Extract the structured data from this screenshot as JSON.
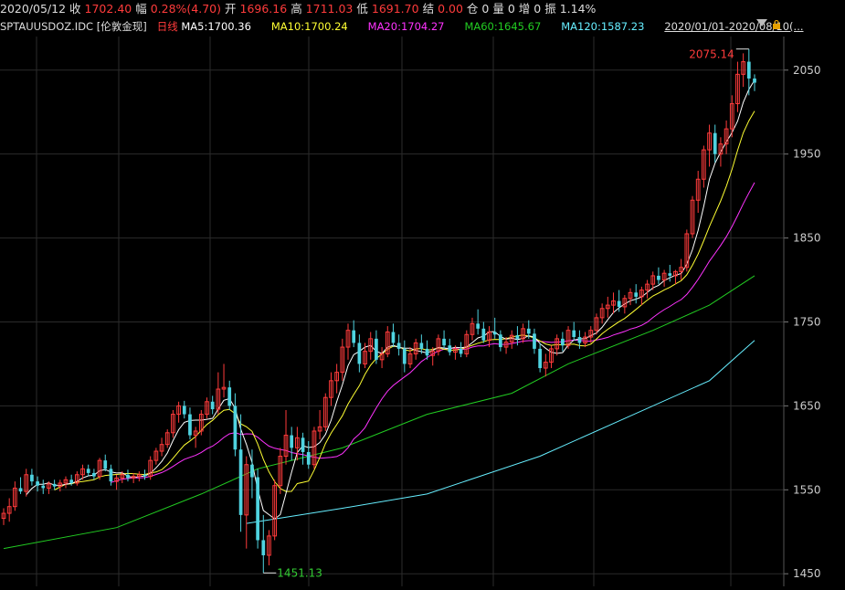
{
  "header": {
    "date": "2020/05/12",
    "close_label": "收",
    "close_value": "1702.40",
    "change_label": "幅",
    "change_value": "0.28%(4.70)",
    "open_label": "开",
    "open_value": "1696.16",
    "high_label": "高",
    "high_value": "1711.03",
    "low_label": "低",
    "low_value": "1691.70",
    "settle_label": "结",
    "settle_value": "0.00",
    "position_label": "仓",
    "position_value": "0",
    "volume_label": "量",
    "volume_value": "0",
    "increase_label": "增",
    "increase_value": "0",
    "amplitude_label": "振",
    "amplitude_value": "1.14%"
  },
  "legend": {
    "symbol": "SPTAUUSDOZ.IDC",
    "name": "[伦敦金现]",
    "period": "日线",
    "ma5": "MA5:1700.36",
    "ma10": "MA10:1700.24",
    "ma20": "MA20:1704.27",
    "ma60": "MA60:1645.67",
    "ma120": "MA120:1587.23",
    "range": "2020/01/01-2020/08/10(..."
  },
  "colors": {
    "up": "#ff3b3b",
    "down": "#4fd3e0",
    "ma5": "#ffffff",
    "ma10": "#ffff33",
    "ma20": "#ff33ff",
    "ma60": "#22cc22",
    "ma120": "#66eeff",
    "grid": "#2b2b2b",
    "high_label": "#ff3b3b",
    "low_label": "#33cc33"
  },
  "chart_data": {
    "type": "candlestick",
    "ylim": [
      1435,
      2090
    ],
    "y_ticks": [
      1450,
      1550,
      1650,
      1750,
      1850,
      1950,
      2050
    ],
    "grid": true,
    "annotations": {
      "max": "2075.14",
      "min": "1451.13"
    },
    "x_range": [
      "2020/01/01",
      "2020/08/10"
    ],
    "candles": [
      [
        1516,
        1528,
        1508,
        1522
      ],
      [
        1522,
        1540,
        1512,
        1530
      ],
      [
        1530,
        1560,
        1525,
        1552
      ],
      [
        1552,
        1565,
        1545,
        1548
      ],
      [
        1548,
        1575,
        1542,
        1568
      ],
      [
        1568,
        1575,
        1555,
        1560
      ],
      [
        1560,
        1566,
        1548,
        1555
      ],
      [
        1555,
        1562,
        1545,
        1552
      ],
      [
        1552,
        1560,
        1545,
        1557
      ],
      [
        1557,
        1562,
        1550,
        1554
      ],
      [
        1554,
        1562,
        1548,
        1558
      ],
      [
        1558,
        1566,
        1552,
        1562
      ],
      [
        1562,
        1568,
        1555,
        1558
      ],
      [
        1558,
        1572,
        1555,
        1568
      ],
      [
        1568,
        1580,
        1562,
        1575
      ],
      [
        1575,
        1580,
        1566,
        1570
      ],
      [
        1570,
        1575,
        1562,
        1566
      ],
      [
        1566,
        1588,
        1562,
        1585
      ],
      [
        1585,
        1592,
        1572,
        1575
      ],
      [
        1575,
        1580,
        1555,
        1560
      ],
      [
        1560,
        1568,
        1550,
        1564
      ],
      [
        1564,
        1572,
        1558,
        1568
      ],
      [
        1568,
        1574,
        1560,
        1564
      ],
      [
        1564,
        1570,
        1558,
        1566
      ],
      [
        1566,
        1572,
        1560,
        1568
      ],
      [
        1568,
        1574,
        1562,
        1566
      ],
      [
        1566,
        1590,
        1562,
        1585
      ],
      [
        1585,
        1600,
        1580,
        1596
      ],
      [
        1596,
        1612,
        1590,
        1604
      ],
      [
        1604,
        1622,
        1600,
        1618
      ],
      [
        1618,
        1645,
        1612,
        1640
      ],
      [
        1640,
        1655,
        1630,
        1650
      ],
      [
        1650,
        1656,
        1635,
        1640
      ],
      [
        1640,
        1648,
        1610,
        1615
      ],
      [
        1615,
        1625,
        1600,
        1620
      ],
      [
        1620,
        1645,
        1615,
        1640
      ],
      [
        1640,
        1660,
        1635,
        1655
      ],
      [
        1655,
        1662,
        1640,
        1646
      ],
      [
        1646,
        1690,
        1640,
        1670
      ],
      [
        1670,
        1700,
        1660,
        1672
      ],
      [
        1672,
        1680,
        1645,
        1650
      ],
      [
        1650,
        1665,
        1590,
        1598
      ],
      [
        1598,
        1640,
        1500,
        1520
      ],
      [
        1520,
        1590,
        1480,
        1580
      ],
      [
        1580,
        1598,
        1540,
        1565
      ],
      [
        1565,
        1575,
        1480,
        1490
      ],
      [
        1490,
        1520,
        1451,
        1472
      ],
      [
        1472,
        1502,
        1460,
        1495
      ],
      [
        1495,
        1562,
        1490,
        1555
      ],
      [
        1555,
        1600,
        1545,
        1590
      ],
      [
        1590,
        1645,
        1580,
        1615
      ],
      [
        1615,
        1625,
        1585,
        1600
      ],
      [
        1600,
        1625,
        1585,
        1612
      ],
      [
        1612,
        1618,
        1580,
        1595
      ],
      [
        1595,
        1608,
        1575,
        1580
      ],
      [
        1580,
        1625,
        1575,
        1620
      ],
      [
        1620,
        1645,
        1610,
        1625
      ],
      [
        1625,
        1665,
        1620,
        1660
      ],
      [
        1660,
        1690,
        1650,
        1680
      ],
      [
        1680,
        1700,
        1665,
        1690
      ],
      [
        1690,
        1730,
        1680,
        1720
      ],
      [
        1720,
        1748,
        1705,
        1740
      ],
      [
        1740,
        1752,
        1720,
        1725
      ],
      [
        1725,
        1735,
        1690,
        1700
      ],
      [
        1700,
        1725,
        1695,
        1715
      ],
      [
        1715,
        1738,
        1705,
        1730
      ],
      [
        1730,
        1740,
        1700,
        1705
      ],
      [
        1705,
        1720,
        1695,
        1712
      ],
      [
        1712,
        1745,
        1708,
        1738
      ],
      [
        1738,
        1748,
        1720,
        1725
      ],
      [
        1725,
        1735,
        1710,
        1718
      ],
      [
        1718,
        1728,
        1690,
        1700
      ],
      [
        1700,
        1720,
        1695,
        1712
      ],
      [
        1712,
        1730,
        1705,
        1725
      ],
      [
        1725,
        1735,
        1712,
        1718
      ],
      [
        1718,
        1728,
        1705,
        1710
      ],
      [
        1710,
        1720,
        1698,
        1715
      ],
      [
        1715,
        1735,
        1710,
        1730
      ],
      [
        1730,
        1740,
        1718,
        1722
      ],
      [
        1722,
        1730,
        1710,
        1714
      ],
      [
        1714,
        1722,
        1705,
        1718
      ],
      [
        1718,
        1726,
        1708,
        1712
      ],
      [
        1712,
        1740,
        1708,
        1735
      ],
      [
        1735,
        1755,
        1728,
        1748
      ],
      [
        1748,
        1765,
        1735,
        1742
      ],
      [
        1742,
        1750,
        1725,
        1728
      ],
      [
        1728,
        1745,
        1720,
        1738
      ],
      [
        1738,
        1755,
        1730,
        1735
      ],
      [
        1735,
        1740,
        1715,
        1720
      ],
      [
        1720,
        1732,
        1712,
        1726
      ],
      [
        1726,
        1740,
        1718,
        1734
      ],
      [
        1734,
        1745,
        1722,
        1730
      ],
      [
        1730,
        1748,
        1725,
        1742
      ],
      [
        1742,
        1752,
        1730,
        1736
      ],
      [
        1736,
        1742,
        1712,
        1718
      ],
      [
        1718,
        1725,
        1690,
        1695
      ],
      [
        1695,
        1712,
        1685,
        1702
      ],
      [
        1702,
        1722,
        1695,
        1718
      ],
      [
        1718,
        1735,
        1710,
        1730
      ],
      [
        1730,
        1738,
        1715,
        1722
      ],
      [
        1722,
        1745,
        1718,
        1740
      ],
      [
        1740,
        1750,
        1728,
        1732
      ],
      [
        1732,
        1740,
        1718,
        1725
      ],
      [
        1725,
        1738,
        1720,
        1732
      ],
      [
        1732,
        1745,
        1725,
        1740
      ],
      [
        1740,
        1760,
        1735,
        1755
      ],
      [
        1755,
        1772,
        1748,
        1766
      ],
      [
        1766,
        1780,
        1755,
        1770
      ],
      [
        1770,
        1785,
        1760,
        1775
      ],
      [
        1775,
        1788,
        1762,
        1768
      ],
      [
        1768,
        1782,
        1760,
        1778
      ],
      [
        1778,
        1790,
        1770,
        1785
      ],
      [
        1785,
        1795,
        1772,
        1780
      ],
      [
        1780,
        1792,
        1770,
        1788
      ],
      [
        1788,
        1800,
        1778,
        1795
      ],
      [
        1795,
        1810,
        1788,
        1805
      ],
      [
        1805,
        1815,
        1795,
        1800
      ],
      [
        1800,
        1812,
        1792,
        1808
      ],
      [
        1808,
        1818,
        1798,
        1805
      ],
      [
        1805,
        1812,
        1795,
        1810
      ],
      [
        1810,
        1825,
        1800,
        1815
      ],
      [
        1815,
        1860,
        1810,
        1855
      ],
      [
        1855,
        1900,
        1850,
        1895
      ],
      [
        1895,
        1930,
        1880,
        1920
      ],
      [
        1920,
        1960,
        1910,
        1955
      ],
      [
        1955,
        1985,
        1935,
        1975
      ],
      [
        1975,
        1985,
        1940,
        1950
      ],
      [
        1950,
        1970,
        1935,
        1962
      ],
      [
        1962,
        1990,
        1950,
        1980
      ],
      [
        1980,
        2020,
        1970,
        2010
      ],
      [
        2010,
        2060,
        2000,
        2045
      ],
      [
        2045,
        2070,
        2030,
        2060
      ],
      [
        2060,
        2075.14,
        2020,
        2040
      ],
      [
        2040,
        2045,
        2025,
        2035
      ]
    ]
  }
}
